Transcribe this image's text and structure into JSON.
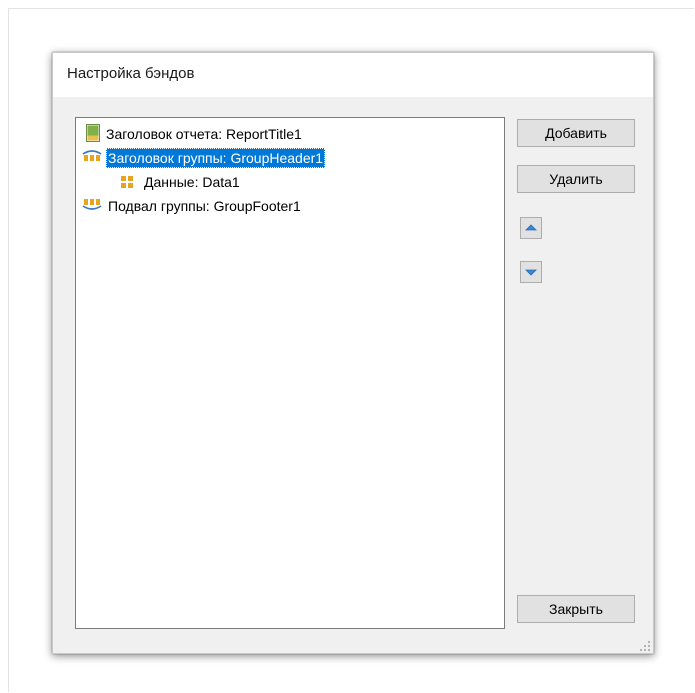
{
  "dialog": {
    "title": "Настройка бэндов"
  },
  "tree": {
    "items": [
      {
        "label": "Заголовок отчета: ReportTitle1",
        "icon": "report-title-icon"
      },
      {
        "label": "Заголовок группы: GroupHeader1",
        "icon": "group-header-icon",
        "selected": true
      },
      {
        "label": "Данные: Data1",
        "icon": "data-band-icon"
      },
      {
        "label": "Подвал группы: GroupFooter1",
        "icon": "group-footer-icon"
      }
    ]
  },
  "buttons": {
    "add": "Добавить",
    "delete": "Удалить",
    "move_up_icon": "arrow-up-icon",
    "move_down_icon": "arrow-down-icon",
    "close": "Закрыть"
  },
  "colors": {
    "selection": "#0078d7",
    "dialog_bg": "#f0f0f0",
    "button_bg": "#e1e1e1"
  }
}
